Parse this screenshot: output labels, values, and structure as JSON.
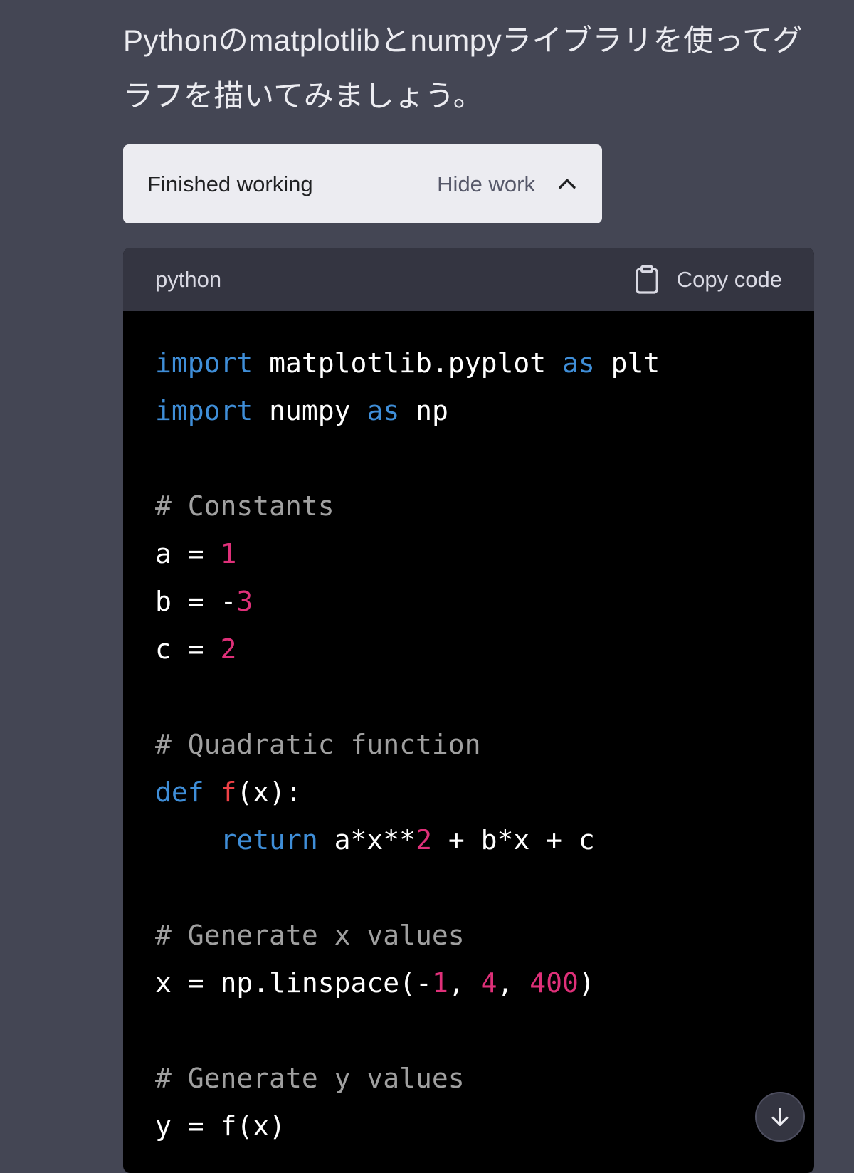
{
  "message": {
    "intro_text": "Pythonのmatplotlibとnumpyライブラリを使ってグラフを描いてみましょう。"
  },
  "work_status": {
    "label": "Finished working",
    "toggle_label": "Hide work",
    "toggle_icon": "chevron-up-icon"
  },
  "code_block": {
    "language": "python",
    "copy_label": "Copy code",
    "copy_icon": "clipboard-icon",
    "lines": [
      [
        {
          "t": "import",
          "k": "kw"
        },
        {
          "t": " matplotlib.pyplot ",
          "k": ""
        },
        {
          "t": "as",
          "k": "kw"
        },
        {
          "t": " plt",
          "k": ""
        }
      ],
      [
        {
          "t": "import",
          "k": "kw"
        },
        {
          "t": " numpy ",
          "k": ""
        },
        {
          "t": "as",
          "k": "kw"
        },
        {
          "t": " np",
          "k": ""
        }
      ],
      [],
      [
        {
          "t": "# Constants",
          "k": "cm"
        }
      ],
      [
        {
          "t": "a = ",
          "k": ""
        },
        {
          "t": "1",
          "k": "num"
        }
      ],
      [
        {
          "t": "b = -",
          "k": ""
        },
        {
          "t": "3",
          "k": "num"
        }
      ],
      [
        {
          "t": "c = ",
          "k": ""
        },
        {
          "t": "2",
          "k": "num"
        }
      ],
      [],
      [
        {
          "t": "# Quadratic function",
          "k": "cm"
        }
      ],
      [
        {
          "t": "def",
          "k": "kw"
        },
        {
          "t": " ",
          "k": ""
        },
        {
          "t": "f",
          "k": "fn"
        },
        {
          "t": "(x):",
          "k": ""
        }
      ],
      [
        {
          "t": "    ",
          "k": ""
        },
        {
          "t": "return",
          "k": "kw"
        },
        {
          "t": " a*x**",
          "k": ""
        },
        {
          "t": "2",
          "k": "num"
        },
        {
          "t": " + b*x + c",
          "k": ""
        }
      ],
      [],
      [
        {
          "t": "# Generate x values",
          "k": "cm"
        }
      ],
      [
        {
          "t": "x = np.linspace(-",
          "k": ""
        },
        {
          "t": "1",
          "k": "num"
        },
        {
          "t": ", ",
          "k": ""
        },
        {
          "t": "4",
          "k": "num"
        },
        {
          "t": ", ",
          "k": ""
        },
        {
          "t": "400",
          "k": "num"
        },
        {
          "t": ")",
          "k": ""
        }
      ],
      [],
      [
        {
          "t": "# Generate y values",
          "k": "cm"
        }
      ],
      [
        {
          "t": "y = f(x)",
          "k": ""
        }
      ]
    ]
  },
  "scroll_button": {
    "icon": "arrow-down-icon"
  },
  "colors": {
    "background": "#444654",
    "keyword": "#3f8ed8",
    "number": "#df3079",
    "function_name": "#ef4146",
    "comment": "#a0a0a0"
  }
}
